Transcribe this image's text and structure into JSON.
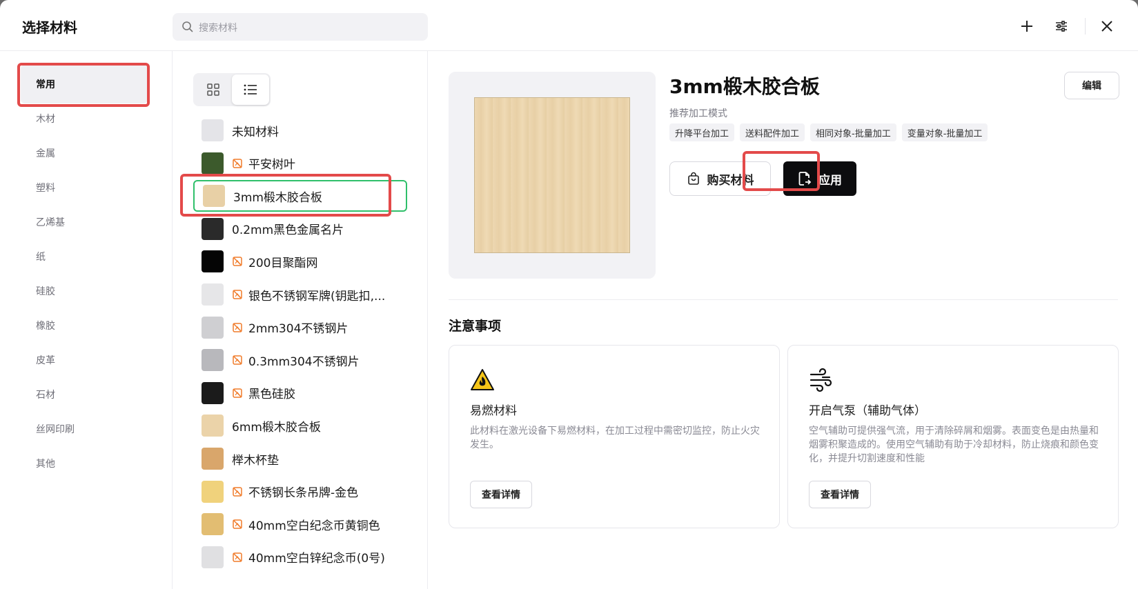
{
  "header": {
    "title": "选择材料",
    "search_placeholder": "搜索材料"
  },
  "categories": [
    "常用",
    "木材",
    "金属",
    "塑料",
    "乙烯基",
    "纸",
    "硅胶",
    "橡胶",
    "皮革",
    "石材",
    "丝网印刷",
    "其他"
  ],
  "active_category": "常用",
  "materials": [
    {
      "name": "未知材料",
      "unlinked": false,
      "thumb": "#e4e4e8"
    },
    {
      "name": "平安树叶",
      "unlinked": true,
      "thumb": "#3c5a2c"
    },
    {
      "name": "3mm椴木胶合板",
      "unlinked": false,
      "thumb": "#e8d0a6"
    },
    {
      "name": "0.2mm黑色金属名片",
      "unlinked": false,
      "thumb": "#2a2a2a"
    },
    {
      "name": "200目聚酯网",
      "unlinked": true,
      "thumb": "#050505"
    },
    {
      "name": "银色不锈钢军牌(钥匙扣,...",
      "unlinked": true,
      "thumb": "#e6e6e8"
    },
    {
      "name": "2mm304不锈钢片",
      "unlinked": true,
      "thumb": "#cfcfd2"
    },
    {
      "name": "0.3mm304不锈钢片",
      "unlinked": true,
      "thumb": "#b8b8bc"
    },
    {
      "name": "黑色硅胶",
      "unlinked": true,
      "thumb": "#1b1b1b"
    },
    {
      "name": "6mm椴木胶合板",
      "unlinked": false,
      "thumb": "#ebd3a9"
    },
    {
      "name": "榉木杯垫",
      "unlinked": false,
      "thumb": "#d9a66b"
    },
    {
      "name": "不锈钢长条吊牌-金色",
      "unlinked": true,
      "thumb": "#f0d27c"
    },
    {
      "name": "40mm空白纪念币黄铜色",
      "unlinked": true,
      "thumb": "#e2bd72"
    },
    {
      "name": "40mm空白锌纪念币(0号)",
      "unlinked": true,
      "thumb": "#e0e0e2"
    }
  ],
  "selected_index": 2,
  "detail": {
    "name": "3mm椴木胶合板",
    "mode_label": "推荐加工模式",
    "modes": [
      "升降平台加工",
      "送料配件加工",
      "相同对象-批量加工",
      "变量对象-批量加工"
    ],
    "edit_label": "编辑",
    "buy_label": "购买材料",
    "apply_label": "应用",
    "notes_title": "注意事项",
    "notes": [
      {
        "icon": "flammable-warning-icon",
        "title": "易燃材料",
        "desc": "此材料在激光设备下易燃材料，在加工过程中需密切监控，防止火灾发生。",
        "button": "查看详情"
      },
      {
        "icon": "air-assist-icon",
        "title": "开启气泵（辅助气体）",
        "desc": "空气辅助可提供强气流，用于清除碎屑和烟雾。表面变色是由热量和烟雾积聚造成的。使用空气辅助有助于冷却材料，防止烧痕和颜色变化，并提升切割速度和性能",
        "button": "查看详情"
      }
    ]
  },
  "colors": {
    "accent_dark": "#0c0c0e",
    "highlight_red": "#e34a4a",
    "selected_green": "#2fbf6a",
    "unlinked_orange": "#f07b2a"
  }
}
